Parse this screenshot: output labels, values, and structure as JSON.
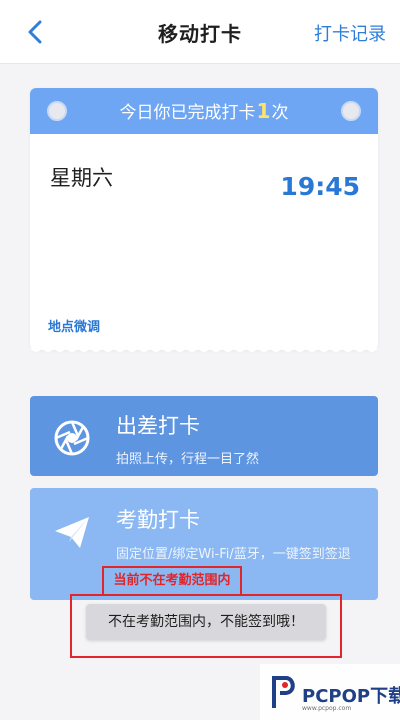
{
  "header": {
    "title": "移动打卡",
    "record_link": "打卡记录",
    "back_icon": "chevron-left-icon"
  },
  "today_card": {
    "banner_prefix": "今日你已完成打卡",
    "banner_count": "1",
    "banner_suffix": "次",
    "weekday": "星期六",
    "time": "19:45",
    "location_adjust": "地点微调"
  },
  "actions": {
    "trip": {
      "title": "出差打卡",
      "description": "拍照上传，行程一目了然",
      "icon": "camera-shutter-icon"
    },
    "attendance": {
      "title": "考勤打卡",
      "description": "固定位置/绑定Wi-Fi/蓝牙，一键签到签退",
      "icon": "paper-plane-icon",
      "range_warning": "当前不在考勤范围内"
    }
  },
  "toast": {
    "message": "不在考勤范围内，不能签到哦！"
  },
  "watermark": {
    "text": "PCPOP下载",
    "subtext": "www.pcpop.com"
  },
  "colors": {
    "accent": "#2a78d6",
    "banner": "#6ea6f4",
    "trip_card": "#5d95e1",
    "attendance_card": "#8bb8f2",
    "highlight": "#e0262b"
  }
}
